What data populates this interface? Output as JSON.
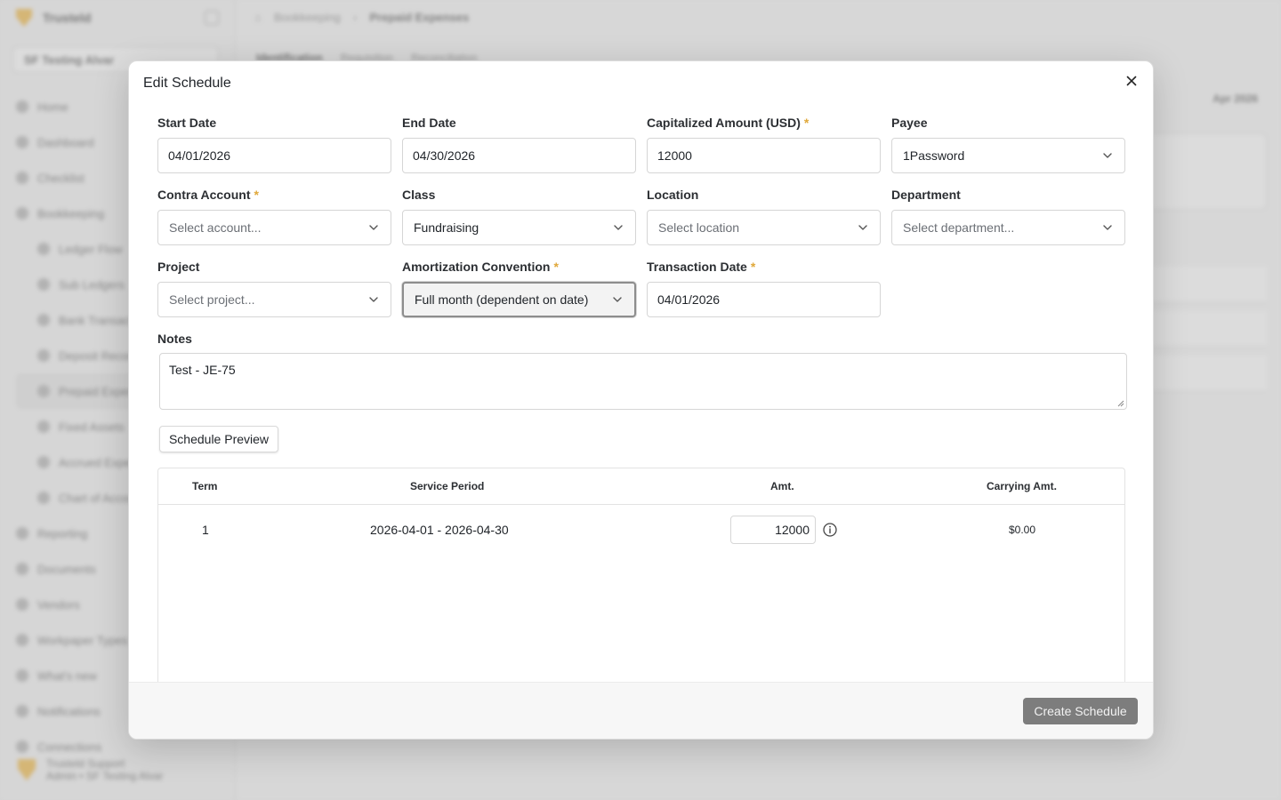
{
  "background": {
    "brand": "Trusteld",
    "org": "SF Testing Alvar",
    "breadcrumb": [
      "Bookkeeping",
      "Prepaid Expenses"
    ],
    "tabs": [
      "Identification",
      "Requisition",
      "Reconciliation"
    ],
    "period": "Apr 2026",
    "nav": [
      {
        "label": "Home",
        "sub": false
      },
      {
        "label": "Dashboard",
        "sub": false
      },
      {
        "label": "Checklist",
        "sub": false
      },
      {
        "label": "Bookkeeping",
        "sub": false
      },
      {
        "label": "Ledger Flow",
        "sub": true
      },
      {
        "label": "Sub Ledgers",
        "sub": true
      },
      {
        "label": "Bank Transactions",
        "sub": true
      },
      {
        "label": "Deposit Recon",
        "sub": true
      },
      {
        "label": "Prepaid Expenses",
        "sub": true,
        "active": true
      },
      {
        "label": "Fixed Assets",
        "sub": true
      },
      {
        "label": "Accrued Expenses",
        "sub": true
      },
      {
        "label": "Chart of Accounts",
        "sub": true
      },
      {
        "label": "Reporting",
        "sub": false
      },
      {
        "label": "Documents",
        "sub": false
      },
      {
        "label": "Vendors",
        "sub": false
      },
      {
        "label": "Workpaper Types",
        "sub": false
      },
      {
        "label": "What's new",
        "sub": false
      },
      {
        "label": "Notifications",
        "sub": false
      },
      {
        "label": "Connections",
        "sub": false
      }
    ],
    "user_name": "Trusteld Support",
    "user_role": "Admin • SF Testing Alvar"
  },
  "modal": {
    "title": "Edit Schedule",
    "fields": {
      "start_date": {
        "label": "Start Date",
        "value": "04/01/2026"
      },
      "end_date": {
        "label": "End Date",
        "value": "04/30/2026"
      },
      "capitalized_amount": {
        "label": "Capitalized Amount (USD)",
        "value": "12000",
        "required": "*"
      },
      "payee": {
        "label": "Payee",
        "value": "1Password"
      },
      "contra_account": {
        "label": "Contra Account",
        "placeholder": "Select account...",
        "required": "*"
      },
      "class": {
        "label": "Class",
        "value": "Fundraising"
      },
      "location": {
        "label": "Location",
        "placeholder": "Select location"
      },
      "department": {
        "label": "Department",
        "placeholder": "Select department..."
      },
      "project": {
        "label": "Project",
        "placeholder": "Select project..."
      },
      "amortization_convention": {
        "label": "Amortization Convention",
        "value": "Full month (dependent on date)",
        "required": "*"
      },
      "transaction_date": {
        "label": "Transaction Date",
        "value": "04/01/2026",
        "required": "*"
      },
      "notes": {
        "label": "Notes",
        "value": "Test - JE-75"
      }
    },
    "preview_button": "Schedule Preview",
    "table": {
      "headers": {
        "term": "Term",
        "service_period": "Service Period",
        "amt": "Amt.",
        "carrying_amt": "Carrying Amt."
      },
      "rows": [
        {
          "term": "1",
          "service_period": "2026-04-01 - 2026-04-30",
          "amt": "12000",
          "carrying_amt": "$0.00"
        }
      ]
    },
    "create_button": "Create Schedule"
  },
  "icons": {
    "close": "close-icon",
    "chevron": "chevron-down-icon",
    "info": "info-icon"
  },
  "colors": {
    "required": "#e0a83a",
    "create_button_bg": "#7d7d7d"
  }
}
